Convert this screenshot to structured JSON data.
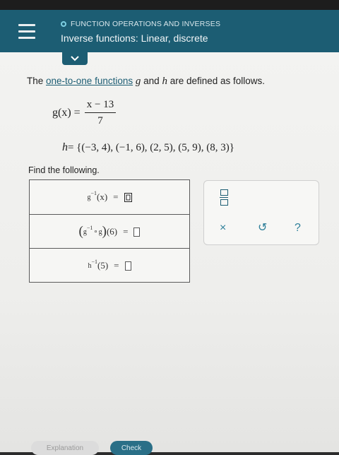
{
  "header": {
    "topic": "FUNCTION OPERATIONS AND INVERSES",
    "subtitle": "Inverse functions: Linear, discrete"
  },
  "prompt": {
    "prefix": "The ",
    "link": "one-to-one functions",
    "var_g": "g",
    "and": "and",
    "var_h": "h",
    "suffix": "are defined as follows."
  },
  "g_def": {
    "lhs": "g(x) =",
    "numerator": "x − 13",
    "denominator": "7"
  },
  "h_def": {
    "lhs": "h",
    "set": "= {(−3, 4), (−1, 6), (2, 5), (5, 9), (8, 3)}"
  },
  "find_label": "Find the following.",
  "questions": [
    {
      "func": "g",
      "sup": "−1",
      "arg": "(x)",
      "eq": "="
    },
    {
      "open": "(",
      "func": "g",
      "sup": "−1",
      "op": "∘",
      "func2": "g",
      "close": ")",
      "arg": "(6)",
      "eq": "="
    },
    {
      "func": "h",
      "sup": "−1",
      "arg": "(5)",
      "eq": "="
    }
  ],
  "keypad": {
    "clear": "×",
    "undo": "↺",
    "help": "?"
  },
  "buttons": {
    "explanation": "Explanation",
    "check": "Check"
  }
}
